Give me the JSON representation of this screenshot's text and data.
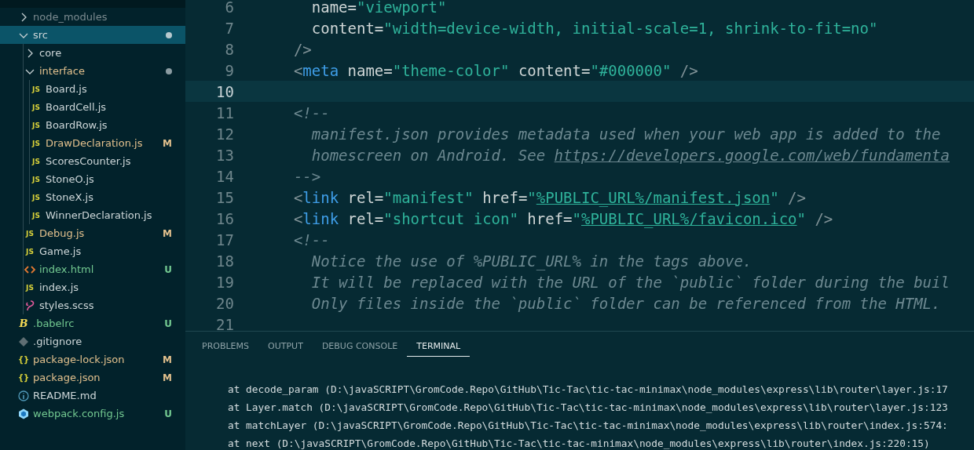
{
  "explorer": {
    "items": [
      {
        "name": "node_modules",
        "kind": "folder",
        "expanded": false,
        "ignored": true,
        "modified": false,
        "untracked": false,
        "selected": false
      },
      {
        "name": "src",
        "kind": "folder",
        "expanded": true,
        "ignored": false,
        "modified": false,
        "untracked": false,
        "dot": true,
        "selected": true,
        "children": [
          {
            "name": "core",
            "kind": "folder",
            "expanded": false,
            "ignored": false,
            "modified": false,
            "untracked": false,
            "selected": false
          },
          {
            "name": "interface",
            "kind": "folder",
            "expanded": true,
            "ignored": false,
            "modified": true,
            "untracked": false,
            "dot": true,
            "selected": false,
            "children": [
              {
                "name": "Board.js",
                "kind": "js",
                "icon_label": "JS",
                "ignored": false,
                "modified": false,
                "untracked": false,
                "selected": false
              },
              {
                "name": "BoardCell.js",
                "kind": "js",
                "icon_label": "JS",
                "ignored": false,
                "modified": false,
                "untracked": false,
                "selected": false
              },
              {
                "name": "BoardRow.js",
                "kind": "js",
                "icon_label": "JS",
                "ignored": false,
                "modified": false,
                "untracked": false,
                "selected": false
              },
              {
                "name": "DrawDeclaration.js",
                "kind": "js",
                "icon_label": "JS",
                "ignored": false,
                "modified": true,
                "untracked": false,
                "badge": "M",
                "selected": false
              },
              {
                "name": "ScoresCounter.js",
                "kind": "js",
                "icon_label": "JS",
                "ignored": false,
                "modified": false,
                "untracked": false,
                "selected": false
              },
              {
                "name": "StoneO.js",
                "kind": "js",
                "icon_label": "JS",
                "ignored": false,
                "modified": false,
                "untracked": false,
                "selected": false
              },
              {
                "name": "StoneX.js",
                "kind": "js",
                "icon_label": "JS",
                "ignored": false,
                "modified": false,
                "untracked": false,
                "selected": false
              },
              {
                "name": "WinnerDeclaration.js",
                "kind": "js",
                "icon_label": "JS",
                "ignored": false,
                "modified": false,
                "untracked": false,
                "selected": false
              }
            ]
          },
          {
            "name": "Debug.js",
            "kind": "js",
            "icon_label": "JS",
            "ignored": false,
            "modified": true,
            "untracked": false,
            "badge": "M",
            "selected": false
          },
          {
            "name": "Game.js",
            "kind": "js",
            "icon_label": "JS",
            "ignored": false,
            "modified": false,
            "untracked": false,
            "selected": false
          },
          {
            "name": "index.html",
            "kind": "html",
            "ignored": false,
            "modified": false,
            "untracked": true,
            "badge": "U",
            "selected": false
          },
          {
            "name": "index.js",
            "kind": "js",
            "icon_label": "JS",
            "ignored": false,
            "modified": false,
            "untracked": false,
            "selected": false
          },
          {
            "name": "styles.scss",
            "kind": "scss",
            "ignored": false,
            "modified": false,
            "untracked": false,
            "selected": false
          }
        ]
      },
      {
        "name": ".babelrc",
        "kind": "babel",
        "icon_label": "B",
        "ignored": false,
        "modified": false,
        "untracked": true,
        "badge": "U",
        "selected": false
      },
      {
        "name": ".gitignore",
        "kind": "git",
        "ignored": false,
        "modified": false,
        "untracked": false,
        "selected": false
      },
      {
        "name": "package-lock.json",
        "kind": "json",
        "icon_label": "{}",
        "ignored": false,
        "modified": true,
        "untracked": false,
        "badge": "M",
        "selected": false
      },
      {
        "name": "package.json",
        "kind": "json",
        "icon_label": "{}",
        "ignored": false,
        "modified": true,
        "untracked": false,
        "badge": "M",
        "selected": false
      },
      {
        "name": "README.md",
        "kind": "info",
        "ignored": false,
        "modified": false,
        "untracked": false,
        "selected": false
      },
      {
        "name": "webpack.config.js",
        "kind": "webpack",
        "ignored": false,
        "modified": false,
        "untracked": true,
        "badge": "U",
        "selected": false
      }
    ]
  },
  "editor": {
    "lines": [
      {
        "number": "6",
        "current": false,
        "tokens": [
          {
            "kind": "attr",
            "text": "    name="
          },
          {
            "kind": "string",
            "text": "\"viewport\""
          }
        ]
      },
      {
        "number": "7",
        "current": false,
        "tokens": [
          {
            "kind": "attr",
            "text": "    content="
          },
          {
            "kind": "string",
            "text": "\"width=device-width, initial-scale=1, shrink-to-fit=no\""
          }
        ]
      },
      {
        "number": "8",
        "current": false,
        "tokens": [
          {
            "kind": "punct",
            "text": "  />"
          }
        ]
      },
      {
        "number": "9",
        "current": false,
        "tokens": [
          {
            "kind": "punct",
            "text": "  <"
          },
          {
            "kind": "tag",
            "text": "meta"
          },
          {
            "kind": "attr",
            "text": " name="
          },
          {
            "kind": "string",
            "text": "\"theme-color\""
          },
          {
            "kind": "attr",
            "text": " content="
          },
          {
            "kind": "string",
            "text": "\"#000000\""
          },
          {
            "kind": "punct",
            "text": " />"
          }
        ]
      },
      {
        "number": "10",
        "current": true
      },
      {
        "number": "11",
        "current": false,
        "tokens": [
          {
            "kind": "comment",
            "text": "  <!--"
          }
        ]
      },
      {
        "number": "12",
        "current": false,
        "tokens": [
          {
            "kind": "comment",
            "text": "    manifest.json provides metadata used when your web app is added to the"
          }
        ]
      },
      {
        "number": "13",
        "current": false,
        "tokens": [
          {
            "kind": "comment",
            "text": "    homescreen on Android. See "
          },
          {
            "kind": "comment-link",
            "text": "https://developers.google.com/web/fundamenta"
          }
        ]
      },
      {
        "number": "14",
        "current": false,
        "tokens": [
          {
            "kind": "comment",
            "text": "  -->"
          }
        ]
      },
      {
        "number": "15",
        "current": false,
        "tokens": [
          {
            "kind": "punct",
            "text": "  <"
          },
          {
            "kind": "tag",
            "text": "link"
          },
          {
            "kind": "attr",
            "text": " rel="
          },
          {
            "kind": "string",
            "text": "\"manifest\""
          },
          {
            "kind": "attr",
            "text": " href="
          },
          {
            "kind": "string",
            "text": "\""
          },
          {
            "kind": "link",
            "text": "%PUBLIC_URL%/manifest.json"
          },
          {
            "kind": "string",
            "text": "\""
          },
          {
            "kind": "punct",
            "text": " />"
          }
        ]
      },
      {
        "number": "16",
        "current": false,
        "tokens": [
          {
            "kind": "punct",
            "text": "  <"
          },
          {
            "kind": "tag",
            "text": "link"
          },
          {
            "kind": "attr",
            "text": " rel="
          },
          {
            "kind": "string",
            "text": "\"shortcut icon\""
          },
          {
            "kind": "attr",
            "text": " href="
          },
          {
            "kind": "string",
            "text": "\""
          },
          {
            "kind": "link",
            "text": "%PUBLIC_URL%/favicon.ico"
          },
          {
            "kind": "string",
            "text": "\""
          },
          {
            "kind": "punct",
            "text": " />"
          }
        ]
      },
      {
        "number": "17",
        "current": false,
        "tokens": [
          {
            "kind": "comment",
            "text": "  <!--"
          }
        ]
      },
      {
        "number": "18",
        "current": false,
        "tokens": [
          {
            "kind": "comment",
            "text": "    Notice the use of %PUBLIC_URL% in the tags above."
          }
        ]
      },
      {
        "number": "19",
        "current": false,
        "tokens": [
          {
            "kind": "comment",
            "text": "    It will be replaced with the URL of the `public` folder during the buil"
          }
        ]
      },
      {
        "number": "20",
        "current": false,
        "tokens": [
          {
            "kind": "comment",
            "text": "    Only files inside the `public` folder can be referenced from the HTML."
          }
        ]
      },
      {
        "number": "21",
        "current": false
      }
    ]
  },
  "panel": {
    "tabs": [
      {
        "label": "PROBLEMS",
        "selected": false
      },
      {
        "label": "OUTPUT",
        "selected": false
      },
      {
        "label": "DEBUG CONSOLE",
        "selected": false
      },
      {
        "label": "TERMINAL",
        "selected": true
      }
    ],
    "terminal_lines": [
      "at decode_param (D:\\javaSCRIPT\\GromCode.Repo\\GitHub\\Tic-Tac\\tic-tac-minimax\\node_modules\\express\\lib\\router\\layer.js:17",
      "at Layer.match (D:\\javaSCRIPT\\GromCode.Repo\\GitHub\\Tic-Tac\\tic-tac-minimax\\node_modules\\express\\lib\\router\\layer.js:123",
      "at matchLayer (D:\\javaSCRIPT\\GromCode.Repo\\GitHub\\Tic-Tac\\tic-tac-minimax\\node_modules\\express\\lib\\router\\index.js:574:",
      "at next (D:\\javaSCRIPT\\GromCode.Repo\\GitHub\\Tic-Tac\\tic-tac-minimax\\node_modules\\express\\lib\\router\\index.js:220:15)"
    ]
  }
}
